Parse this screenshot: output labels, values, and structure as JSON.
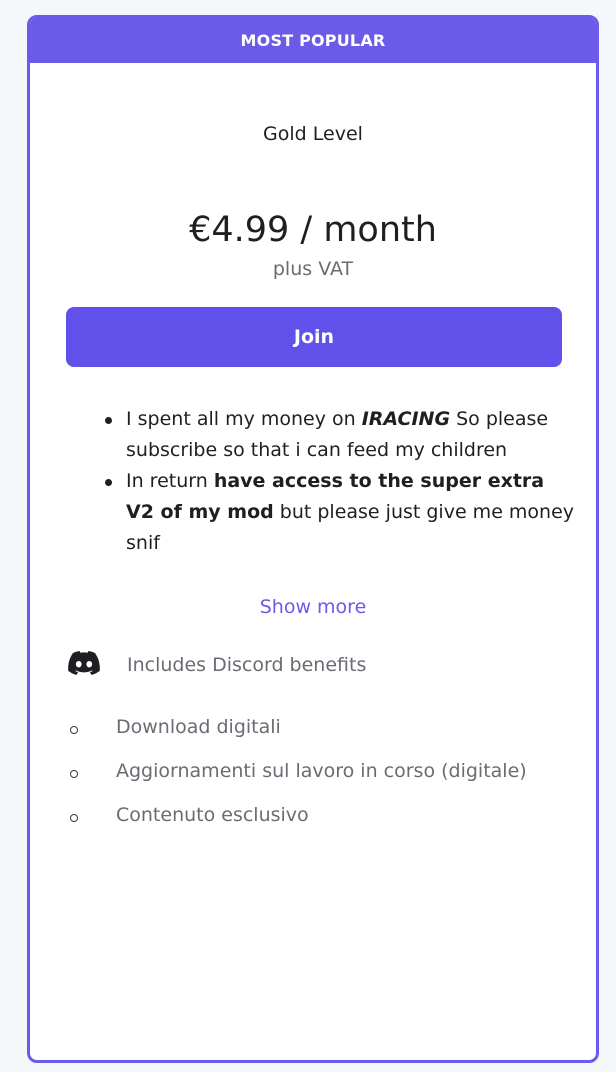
{
  "banner": {
    "label": "MOST POPULAR"
  },
  "tier": {
    "name": "Gold Level",
    "price": "€4.99 / month",
    "tax_note": "plus VAT",
    "join_label": "Join"
  },
  "description": {
    "item1": {
      "text_before": "I spent all my money on ",
      "emphasis": "IRACING",
      "text_after": " So please subscribe so that i can feed my children"
    },
    "item2": {
      "text_before": "In return ",
      "bold": "have access to the super extra V2 of my mod",
      "text_after": " but please just give me money snif"
    }
  },
  "show_more_label": "Show more",
  "discord": {
    "icon": "discord-icon",
    "label": "Includes Discord benefits"
  },
  "benefits": [
    {
      "label": "Download digitali"
    },
    {
      "label": "Aggiornamenti sul lavoro in corso (digitale)"
    },
    {
      "label": "Contenuto esclusivo"
    }
  ],
  "colors": {
    "accent": "#6c5ae8",
    "button": "#6150ea",
    "text": "#1f1f23",
    "muted": "#6b6b73",
    "background": "#f6f7fb"
  }
}
